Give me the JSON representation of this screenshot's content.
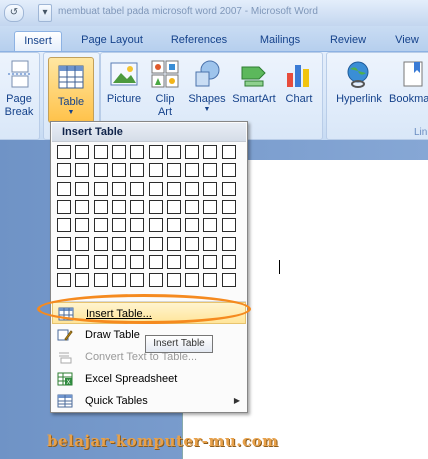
{
  "titlebar": {
    "undo_glyph": "↺",
    "dropdown_glyph": "▾",
    "title": "membuat tabel pada microsoft word 2007 - Microsoft Word"
  },
  "tabs": [
    {
      "label": "Insert",
      "active": true
    },
    {
      "label": "Page Layout"
    },
    {
      "label": "References"
    },
    {
      "label": "Mailings"
    },
    {
      "label": "Review"
    },
    {
      "label": "View"
    }
  ],
  "ribbon": {
    "page_break": {
      "line1": "Page",
      "line2": "Break"
    },
    "table": {
      "label": "Table",
      "caret": "▼"
    },
    "picture": {
      "label": "Picture"
    },
    "clip_art": {
      "line1": "Clip",
      "line2": "Art"
    },
    "shapes": {
      "label": "Shapes",
      "caret": "▼"
    },
    "smartart": {
      "label": "SmartArt"
    },
    "chart": {
      "label": "Chart"
    },
    "hyperlink": {
      "label": "Hyperlink"
    },
    "bookmark": {
      "label": "Bookmark"
    },
    "links_group_label": "Lin"
  },
  "menu": {
    "header": "Insert Table",
    "grid_rows": 8,
    "grid_cols": 10,
    "items": [
      {
        "label": "Insert Table...",
        "icon": "table-grid-icon",
        "state": "hover"
      },
      {
        "label": "Draw Table",
        "icon": "pencil-icon"
      },
      {
        "label": "Convert Text to Table...",
        "icon": "convert-icon",
        "state": "disabled"
      },
      {
        "label": "Excel Spreadsheet",
        "icon": "excel-icon"
      },
      {
        "label": "Quick Tables",
        "icon": "quick-tables-icon",
        "submenu_arrow": "▶"
      }
    ]
  },
  "tooltip": "Insert Table",
  "watermark": "belajar-komputer-mu.com",
  "colors": {
    "highlight_ellipse": "#f58a1f",
    "watermark": "#e8a14a",
    "ribbon_text": "#15428b",
    "doc_background": "#6f93c6"
  }
}
